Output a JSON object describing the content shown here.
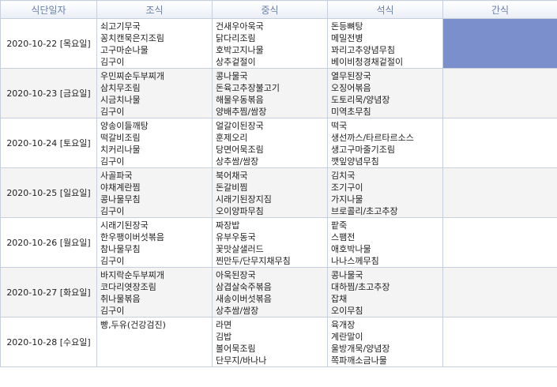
{
  "headers": [
    "식단일자",
    "조식",
    "중식",
    "석식",
    "간식"
  ],
  "rows": [
    {
      "date": "2020-10-22 [목요일]",
      "breakfast": [
        "쇠고기무국",
        "꽁치캔묵은지조림",
        "고구마순나물",
        "김구이"
      ],
      "lunch": [
        "건새우아욱국",
        "닭다리조림",
        "호박고지나물",
        "상추겉절이"
      ],
      "dinner": [
        "돈등뼈탕",
        "메밀전병",
        "꽈리고추양념무침",
        "베이비청경채겉절이"
      ],
      "snack": [],
      "snack_highlight": true
    },
    {
      "date": "2020-10-23 [금요일]",
      "breakfast": [
        "우민찌순두부찌개",
        "삼치무조림",
        "시금치나물",
        "김구이"
      ],
      "lunch": [
        "콩나물국",
        "돈육고추장불고기",
        "해물우동볶음",
        "양배추찜/쌈장"
      ],
      "dinner": [
        "열무된장국",
        "오징어볶음",
        "도토리묵/양념장",
        "미역초무침"
      ],
      "snack": [],
      "snack_highlight": false
    },
    {
      "date": "2020-10-24 [토요일]",
      "breakfast": [
        "양송이들깨탕",
        "떡갈비조림",
        "치커리나물",
        "김구이"
      ],
      "lunch": [
        "얼갈이된장국",
        "훈제오리",
        "당면어묵조림",
        "상추쌈/쌈장"
      ],
      "dinner": [
        "떡국",
        "생선까스/타르타르소스",
        "생고구마줄기조림",
        "깻잎양념무침"
      ],
      "snack": [],
      "snack_highlight": false
    },
    {
      "date": "2020-10-25 [일요일]",
      "breakfast": [
        "사골파국",
        "야채계란찜",
        "콩나물무침",
        "김구이"
      ],
      "lunch": [
        "북어채국",
        "돈갈비찜",
        "시래기된장지짐",
        "오이양파무침"
      ],
      "dinner": [
        "김치국",
        "조기구이",
        "가지나물",
        "브로콜리/초고추장"
      ],
      "snack": [],
      "snack_highlight": false
    },
    {
      "date": "2020-10-26 [월요일]",
      "breakfast": [
        "시래기된장국",
        "한우팽이버섯볶음",
        "참나물무침",
        "김구이"
      ],
      "lunch": [
        "짜장밥",
        "유부우동국",
        "꽃맛살샐러드",
        "찐만두/단무지채무침"
      ],
      "dinner": [
        "팥죽",
        "스팸전",
        "애호박나물",
        "나나스께무침"
      ],
      "snack": [],
      "snack_highlight": false
    },
    {
      "date": "2020-10-27 [화요일]",
      "breakfast": [
        "바지락순두부찌개",
        "코다리엿장조림",
        "취나물볶음",
        "김구이"
      ],
      "lunch": [
        "아욱된장국",
        "삼겹살숙주볶음",
        "새송이버섯볶음",
        "상추쌈/쌈장"
      ],
      "dinner": [
        "콩나물국",
        "대하찜/초고추장",
        "잡채",
        "오이무침"
      ],
      "snack": [],
      "snack_highlight": false
    },
    {
      "date": "2020-10-28 [수요일]",
      "breakfast": [
        "빵,두유(건강검진)"
      ],
      "lunch": [
        "라면",
        "김밥",
        "볼어묵조림",
        "단무지/바나나"
      ],
      "dinner": [
        "육개장",
        "계란말이",
        "울방개묵/양념장",
        "쪽파깨소금나물"
      ],
      "snack": [],
      "snack_highlight": false
    }
  ],
  "colors": {
    "header_text": "#6b7fa8",
    "border": "#c7cfdc",
    "alt_row": "#f4f4f4",
    "highlight": "#7b8fcc"
  }
}
